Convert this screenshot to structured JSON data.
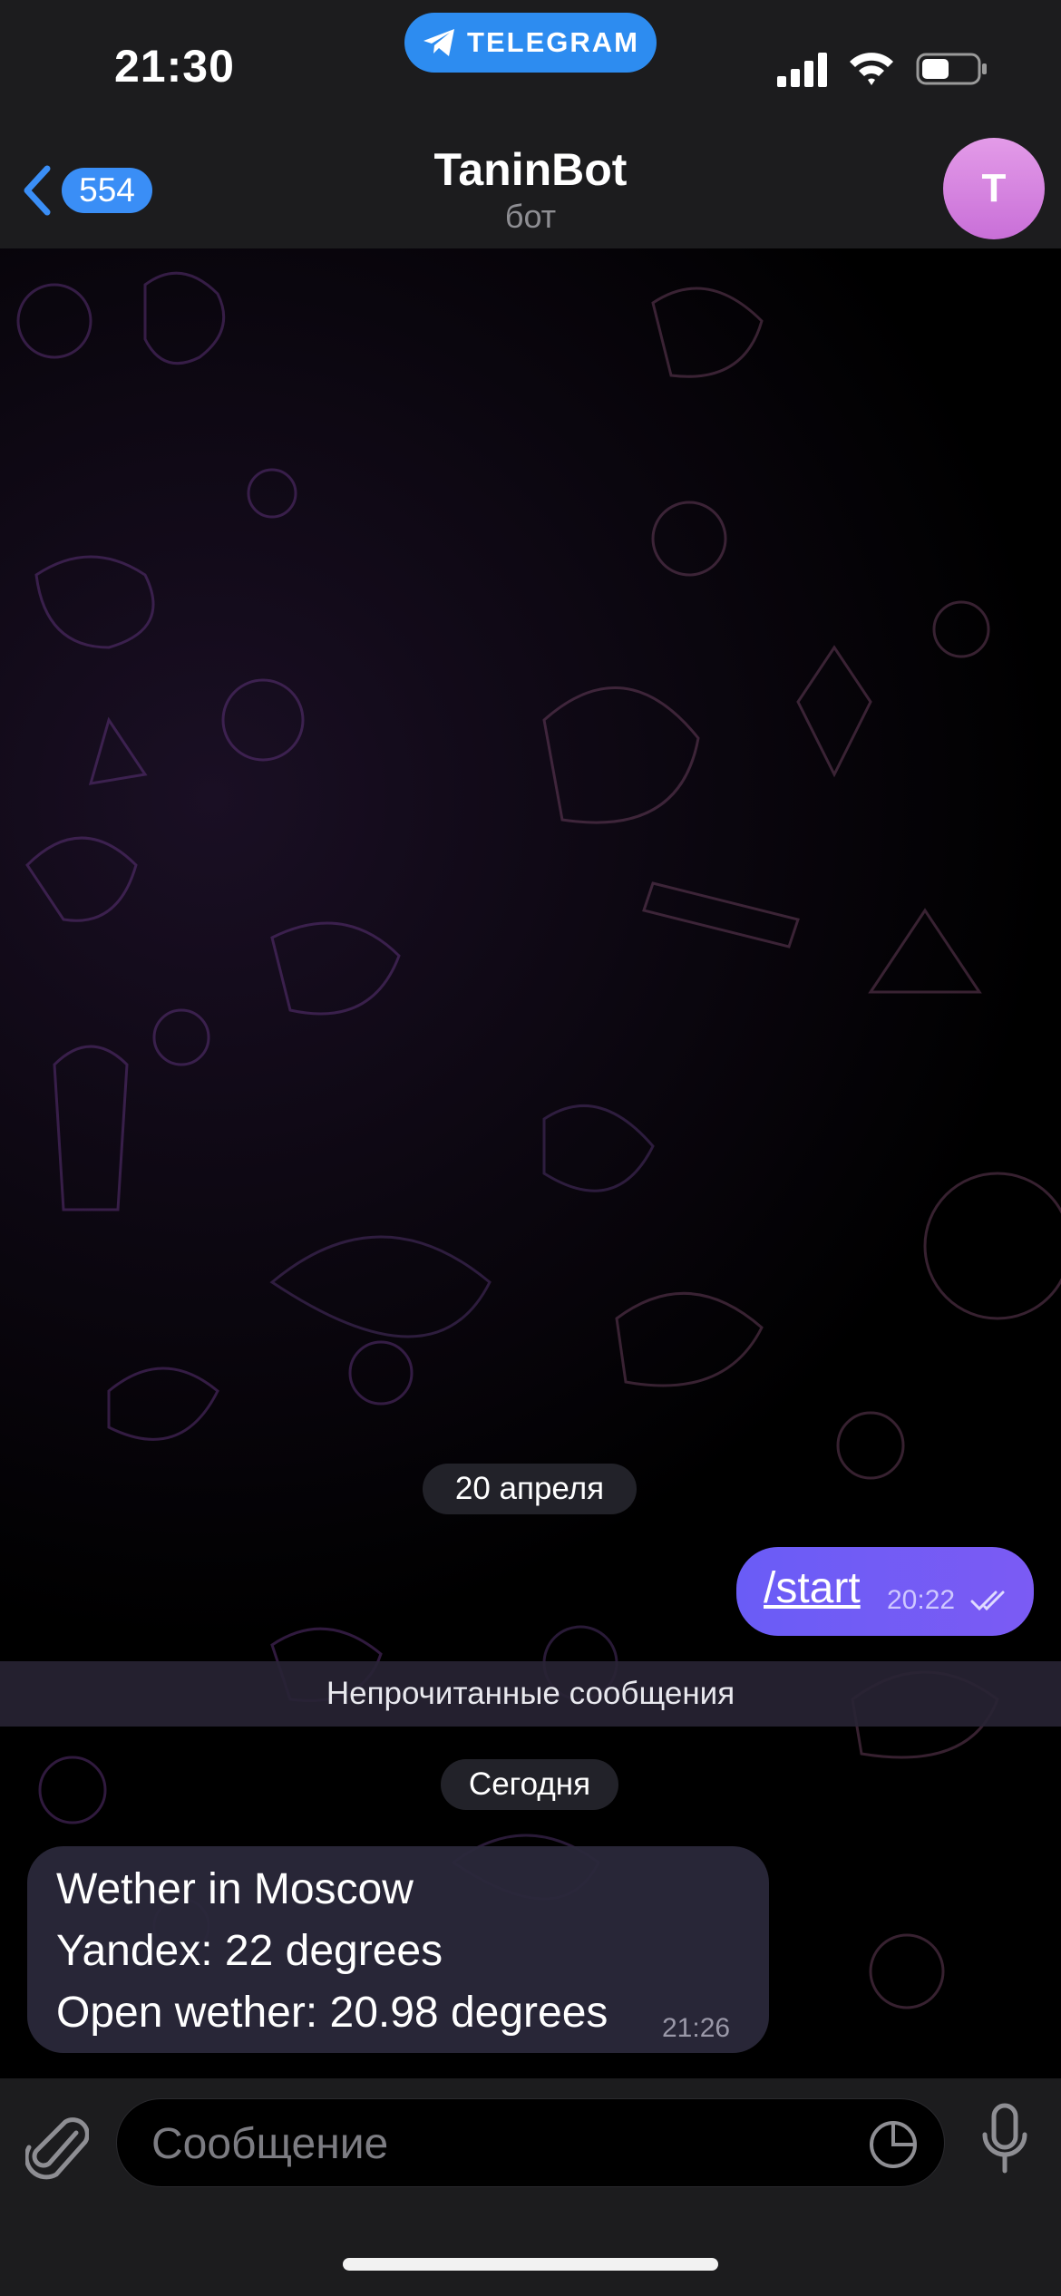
{
  "status_bar": {
    "time": "21:30",
    "telegram_label": "TELEGRAM",
    "battery_level": 0.5
  },
  "nav": {
    "back_count": "554",
    "title": "TaninBot",
    "subtitle": "бот",
    "avatar_letter": "T"
  },
  "messages": {
    "date_1": "20 апреля",
    "outgoing": {
      "text": "/start",
      "time": "20:22"
    },
    "unread_separator": "Непрочитанные сообщения",
    "date_2": "Сегодня",
    "incoming": {
      "lines": [
        "Wether in Moscow",
        "Yandex: 22 degrees",
        "Open wether: 20.98 degrees"
      ],
      "time": "21:26"
    }
  },
  "composer": {
    "placeholder": "Сообщение"
  },
  "colors": {
    "accent": "#3a8ef6",
    "outgoing_bubble": "#6a5cf6",
    "avatar": "#d680e0"
  }
}
